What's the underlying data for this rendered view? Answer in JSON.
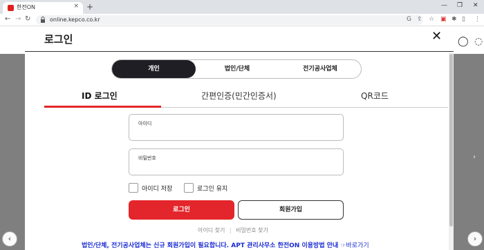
{
  "browser": {
    "tab_title": "한전ON",
    "tab_close": "×",
    "new_tab": "+",
    "url": "online.kepco.co.kr",
    "win_minimize": "—",
    "win_restore": "❐",
    "win_close": "✕"
  },
  "modal": {
    "title": "로그인",
    "close": "✕",
    "segments": [
      "개인",
      "법인/단체",
      "전기공사업체"
    ],
    "tabs": [
      "ID 로그인",
      "간편인증(민간인증서)",
      "QR코드"
    ],
    "id_label": "아이디",
    "pw_label": "비밀번호",
    "save_id": "아이디 저장",
    "keep_login": "로그인 유지",
    "login_button": "로그인",
    "join_button": "회원가입",
    "find_id": "아이디 찾기",
    "find_pw": "비밀번호 찾기",
    "notice": "법인/단체, 전기공사업체는 신규 회원가입이 필요합니다. APT 관리사무소 한전ON 이용방법 안내",
    "notice_link": "☞바로가기"
  },
  "colors": {
    "accent_red": "#e3262b",
    "dark": "#1e1e24",
    "notice_blue": "#1a2bd1"
  }
}
